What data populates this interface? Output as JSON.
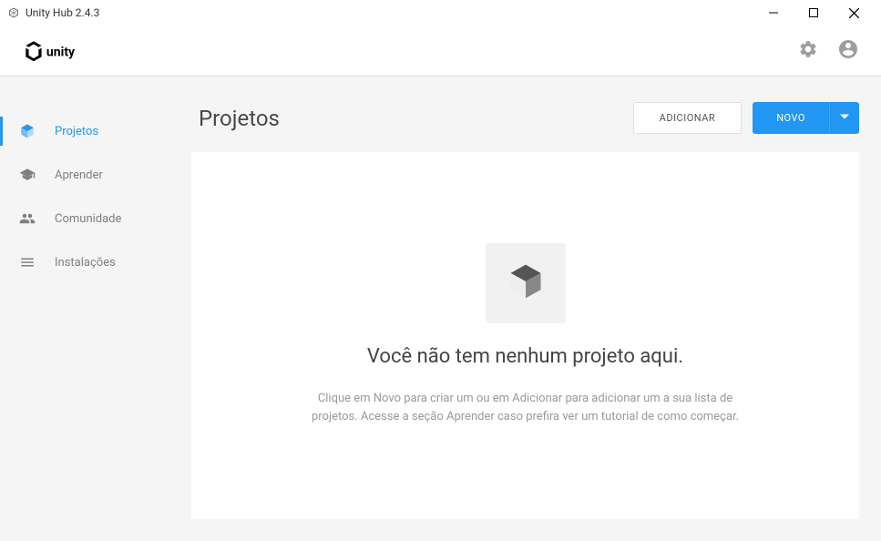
{
  "titlebar": {
    "title": "Unity Hub 2.4.3"
  },
  "sidebar": {
    "items": [
      {
        "label": "Projetos"
      },
      {
        "label": "Aprender"
      },
      {
        "label": "Comunidade"
      },
      {
        "label": "Instalações"
      }
    ]
  },
  "main": {
    "page_title": "Projetos",
    "add_label": "ADICIONAR",
    "new_label": "NOVO",
    "empty_title": "Você não tem nenhum projeto aqui.",
    "empty_desc": "Clique em Novo para criar um ou em Adicionar para adicionar um a sua lista de projetos. Acesse a seção Aprender caso prefira ver um tutorial de como começar."
  }
}
